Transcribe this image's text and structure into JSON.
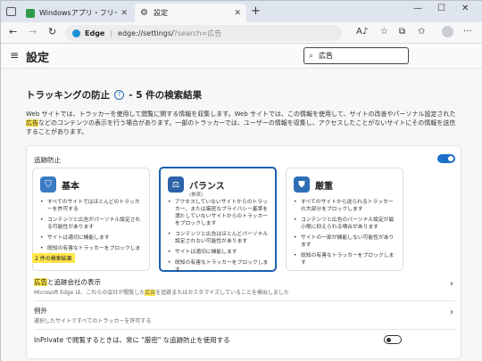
{
  "browser": {
    "tabs": [
      {
        "title": "Windowsアプリ・フリーソフトのおすす",
        "active": false
      },
      {
        "title": "設定",
        "active": true
      }
    ],
    "address": {
      "app_label": "Edge",
      "url_main": "edge://settings/",
      "url_query": "?search=広告"
    }
  },
  "settings": {
    "title": "設定",
    "search": {
      "value": "広告"
    }
  },
  "tracking": {
    "heading_prefix": "トラッキングの防止",
    "heading_suffix": "- 5 件の検索結果",
    "description_pre": "Web サイトでは、トラッカーを使用して閲覧に関する情報を収集します。Web サイトでは、この情報を使用して、サイトの改善やパーソナル設定された",
    "description_mark": "広告",
    "description_post": "などのコンテンツの表示を行う場合があります。一部のトラッカーでは、ユーザーの情報を収集し、アクセスしたことがないサイトにその情報を送信することがあります。",
    "prevention_label": "追跡防止",
    "prevention_enabled": true,
    "levels": [
      {
        "name": "基本",
        "subtitle": "",
        "selected": false,
        "icon": "basic-shield-icon",
        "bullets": [
          "すべてのサイトではほとんどのトラッカーを許可する",
          "コンテンツと広告がパーソナル設定される可能性があります",
          "サイトは適切に機能します",
          "既知の有害なトラッカーをブロックします"
        ]
      },
      {
        "name": "バランス",
        "subtitle": "(推奨)",
        "selected": true,
        "icon": "balance-scale-icon",
        "bullets": [
          "アクセスしていないサイトからのトラッカー、または厳密なプライバシー基準を満たしていないサイトからのトラッカーをブロックします",
          "コンテンツと広告はほとんどパーソナル設定されない可能性があります",
          "サイトは適切に機能します",
          "既知の有害なトラッカーをブロックします"
        ]
      },
      {
        "name": "厳重",
        "subtitle": "",
        "selected": false,
        "icon": "strict-shield-icon",
        "bullets": [
          "すべてのサイトから送られるトラッカーの大部分をブロックします",
          "コンテンツと広告のパーソナル設定が最小限に抑えられる場合があります",
          "サイトの一部が機能しない可能性があります",
          "既知の有害なトラッカーをブロックします"
        ]
      }
    ],
    "results_badge": "2 件の検索結果",
    "rows": [
      {
        "title_mark": "広告",
        "title_rest": "と追跡会社の表示",
        "sub_pre": "Microsoft Edge は、これらの会社が閲覧した",
        "sub_mark": "広告",
        "sub_post": "を追跡またはカスタマイズしていることを検出しました"
      },
      {
        "title": "例外",
        "sub": "選択したサイトですべてのトラッカーを許可する"
      },
      {
        "title": "InPrivate で閲覧するときは、常に \"厳密\" な追跡防止を使用する",
        "enabled": false
      }
    ]
  }
}
